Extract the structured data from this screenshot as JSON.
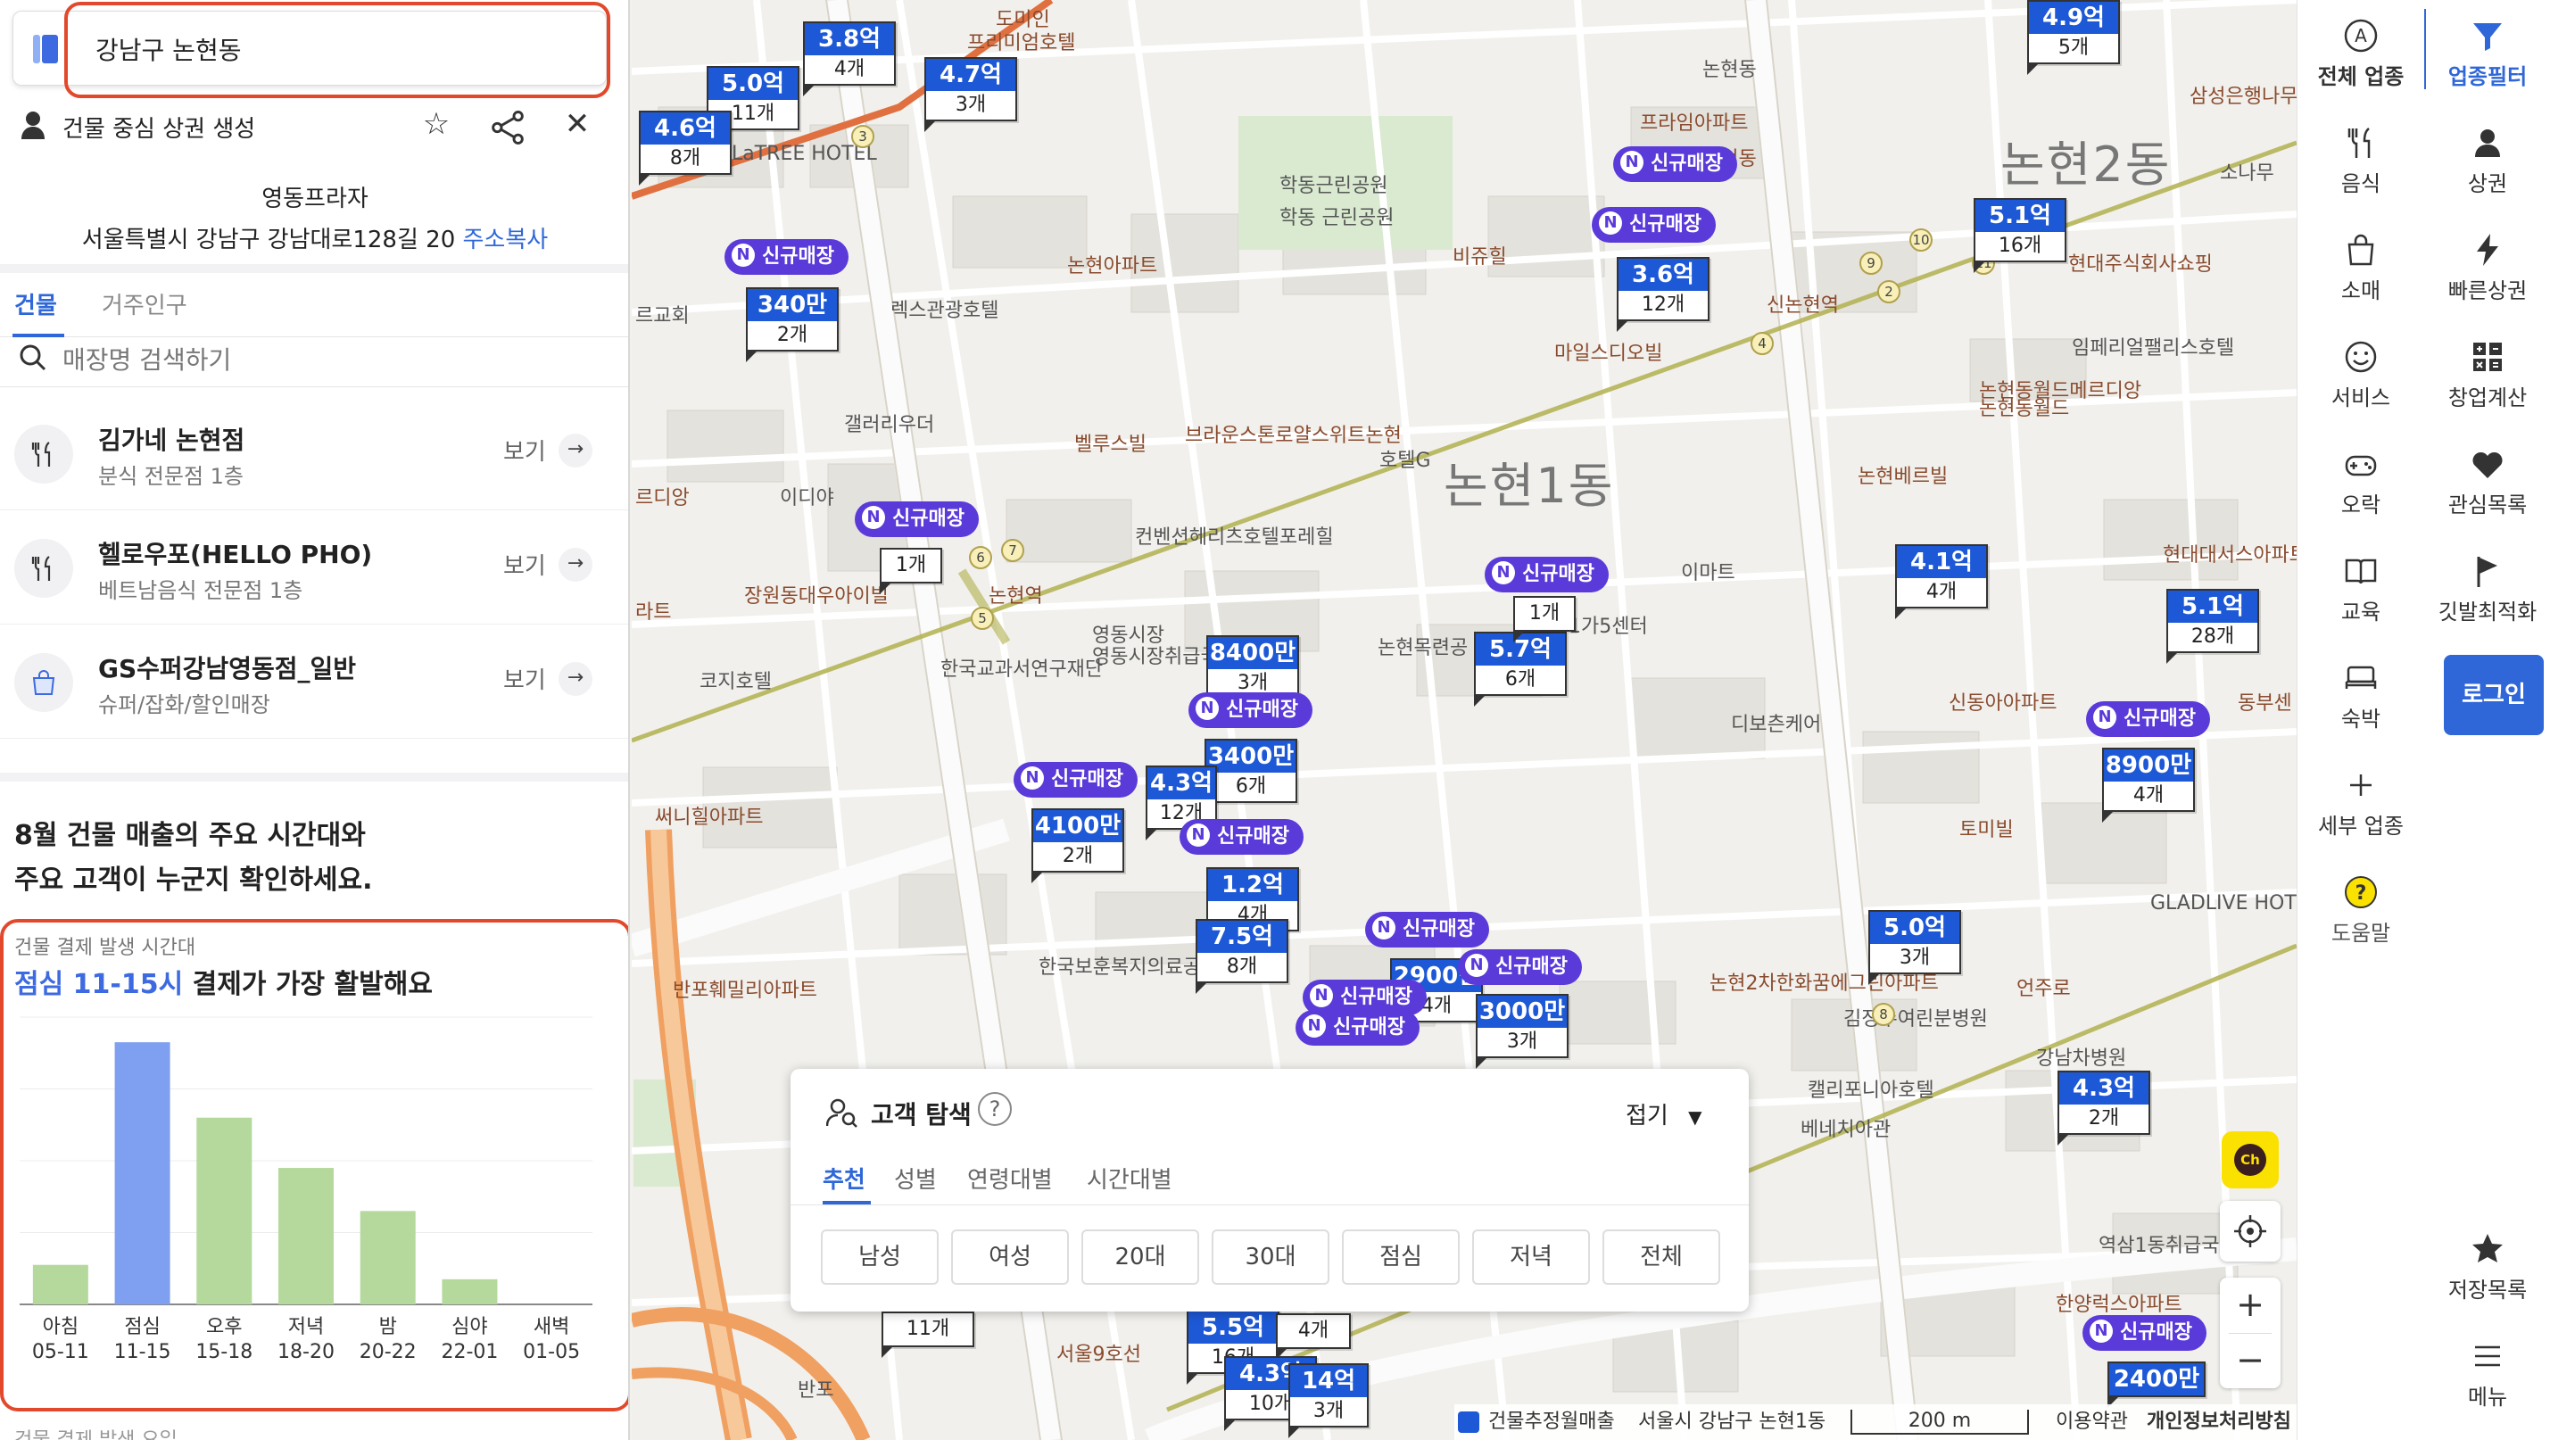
{
  "search": {
    "value": "강남구 논현동"
  },
  "panel": {
    "title": "건물 중심 상권 생성",
    "building_name": "영동프라자",
    "address": "서울특별시 강남구 강남대로128길 20",
    "copy_label": "주소복사",
    "tabs": [
      "건물",
      "거주인구"
    ],
    "store_search_placeholder": "매장명 검색하기",
    "stores": [
      {
        "name": "김가네 논현점",
        "category": "분식 전문점 1층",
        "view": "보기",
        "icon": "fork-knife-icon"
      },
      {
        "name": "헬로우포(HELLO PHO)",
        "category": "베트남음식 전문점 1층",
        "view": "보기",
        "icon": "fork-knife-icon"
      },
      {
        "name": "GS수퍼강남영동점_일반",
        "category": "슈퍼/잡화/할인매장",
        "view": "보기",
        "icon": "shopping-bag-icon"
      }
    ],
    "headline_1": "8월 건물 매출의 주요 시간대와",
    "headline_2": "주요 고객이 누군지 확인하세요.",
    "chart_subtitle": "건물 결제 발생 시간대",
    "busiest_highlight": "점심 11-15시",
    "busiest_rest": " 결제가 가장 활발해요",
    "bottom_cut_text": "건물 결제 발생 요일"
  },
  "chart_data": {
    "type": "bar",
    "categories": [
      "아침 05-11",
      "점심 11-15",
      "오후 15-18",
      "저녁 18-20",
      "밤 20-22",
      "심야 22-01",
      "새벽 01-05"
    ],
    "category_lines": [
      [
        "아침",
        "05-11"
      ],
      [
        "점심",
        "11-15"
      ],
      [
        "오후",
        "15-18"
      ],
      [
        "저녁",
        "18-20"
      ],
      [
        "밤",
        "20-22"
      ],
      [
        "심야",
        "22-01"
      ],
      [
        "새벽",
        "01-05"
      ]
    ],
    "values": [
      11,
      73,
      52,
      38,
      26,
      7,
      0
    ],
    "highlight_index": 1,
    "colors": {
      "normal": "#b5d99c",
      "highlight": "#7f9ff0"
    },
    "ylim": [
      0,
      80
    ],
    "grid": true,
    "title": "",
    "xlabel": "",
    "ylabel": ""
  },
  "map": {
    "area_labels": [
      {
        "text": "논현2동",
        "big": true
      },
      {
        "text": "논현1동",
        "big": true
      },
      {
        "text": "학동근린공원"
      },
      {
        "text": "논현아파트"
      },
      {
        "text": "렉스관광호텔"
      },
      {
        "text": "비쥬힐"
      },
      {
        "text": "마일스디오빌"
      },
      {
        "text": "프라임아파트"
      },
      {
        "text": "임페리얼팰리스호텔"
      },
      {
        "text": "논현동월드메르디앙"
      },
      {
        "text": "논현베르빌"
      },
      {
        "text": "브라운스톤로얄스위트논현"
      },
      {
        "text": "벨루스빌"
      },
      {
        "text": "호텔G"
      },
      {
        "text": "갤러리우더"
      },
      {
        "text": "이디야"
      },
      {
        "text": "장원동대우아이빌"
      },
      {
        "text": "코지호텔"
      },
      {
        "text": "한국교과서연구재단"
      },
      {
        "text": "영동시장취급국"
      },
      {
        "text": "논현목련공"
      },
      {
        "text": "이마트"
      },
      {
        "text": "디보츤케어"
      },
      {
        "text": "신동아아파트"
      },
      {
        "text": "현대대서스아파트"
      },
      {
        "text": "토미빌"
      },
      {
        "text": "써니힐아파트"
      },
      {
        "text": "한국보훈복지의료공단"
      },
      {
        "text": "반포훼밀리아파트"
      },
      {
        "text": "논현2차한화꿈에그린아파트"
      },
      {
        "text": "김정수여린분병원"
      },
      {
        "text": "캘리포니아호텔"
      },
      {
        "text": "베네치아관"
      },
      {
        "text": "강남차병원"
      },
      {
        "text": "GLADLIVE HOTEL"
      },
      {
        "text": "한양럭스아파트"
      },
      {
        "text": "역삼1동취급국"
      },
      {
        "text": "언주로"
      },
      {
        "text": "논현역"
      },
      {
        "text": "신논현역"
      },
      {
        "text": "서울9호선"
      },
      {
        "text": "반포"
      },
      {
        "text": "르교회"
      },
      {
        "text": "라트"
      },
      {
        "text": "르디앙"
      },
      {
        "text": "LaTREE HOTEL"
      },
      {
        "text": "프리미엄호텔"
      },
      {
        "text": "삼성은행나무근린공원"
      },
      {
        "text": "소나무"
      },
      {
        "text": "컨벤션헤리츠호텔포레힐"
      },
      {
        "text": "영동시장"
      },
      {
        "text": "동부센"
      },
      {
        "text": "학동 근린공원"
      },
      {
        "text": "논현동"
      },
      {
        "text": "1가5센터"
      },
      {
        "text": "현대주식회사쇼핑"
      },
      {
        "text": "논현동"
      },
      {
        "text": "논현동월드"
      },
      {
        "text": "도미인"
      }
    ],
    "markers": [
      {
        "price": "3.8억",
        "count": "4개"
      },
      {
        "price": "5.0억",
        "count": "11개"
      },
      {
        "price": "4.7억",
        "count": "3개"
      },
      {
        "price": "4.6억",
        "count": "8개"
      },
      {
        "price": "4.9억",
        "count": "5개"
      },
      {
        "price": "340만",
        "count": "2개"
      },
      {
        "price": "5.1억",
        "count": "16개"
      },
      {
        "price": "3.6억",
        "count": "12개"
      },
      {
        "price": "",
        "count": "1개"
      },
      {
        "price": "4.1억",
        "count": "4개"
      },
      {
        "price": "5.1억",
        "count": "28개"
      },
      {
        "price": "8400만",
        "count": "3개"
      },
      {
        "price": "5.7억",
        "count": "6개"
      },
      {
        "price": "",
        "count": "1개"
      },
      {
        "price": "3400만",
        "count": "6개"
      },
      {
        "price": "4100만",
        "count": "2개"
      },
      {
        "price": "4.3억",
        "count": "12개"
      },
      {
        "price": "8900만",
        "count": "4개"
      },
      {
        "price": "1.2억",
        "count": "4개"
      },
      {
        "price": "7.5억",
        "count": "8개"
      },
      {
        "price": "5.0억",
        "count": "3개"
      },
      {
        "price": "2900만",
        "count": "4개"
      },
      {
        "price": "3000만",
        "count": "3개"
      },
      {
        "price": "4.3억",
        "count": "2개"
      },
      {
        "price": "",
        "count": "11개"
      },
      {
        "price": "5.5억",
        "count": "16개"
      },
      {
        "price": "",
        "count": "4개"
      },
      {
        "price": "4.3억",
        "count": "10개"
      },
      {
        "price": "14억",
        "count": "3개"
      },
      {
        "price": "2400만",
        "count": ""
      }
    ],
    "new_badge": "신규매장",
    "new_badge_n": "N",
    "stations": [
      "3",
      "4",
      "2",
      "5",
      "6",
      "7",
      "8",
      "9",
      "10",
      "11"
    ],
    "customer_panel": {
      "title": "고객 탐색",
      "help": "?",
      "fold": "접기",
      "tabs": [
        "추천",
        "성별",
        "연령대별",
        "시간대별"
      ],
      "chips": [
        "남성",
        "여성",
        "20대",
        "30대",
        "점심",
        "저녁",
        "전체"
      ]
    },
    "kakao_label": "Ch",
    "zoom_in": "+",
    "zoom_out": "−",
    "status": {
      "legend": "건물추정월매출",
      "region": "서울시 강남구 논현1동",
      "scale": "200 m",
      "terms": "이용약관",
      "privacy": "개인정보처리방침"
    }
  },
  "nav": {
    "left_col": [
      "전체 업종",
      "음식",
      "소매",
      "서비스",
      "오락",
      "교육",
      "숙박",
      "세부 업종",
      "도움말"
    ],
    "right_col": [
      "업종필터",
      "상권",
      "빠른상권",
      "창업계산",
      "관심목록",
      "깃발최적화"
    ],
    "login": "로그인",
    "bottom": [
      "저장목록",
      "메뉴"
    ],
    "accent": "#2f67d8"
  }
}
